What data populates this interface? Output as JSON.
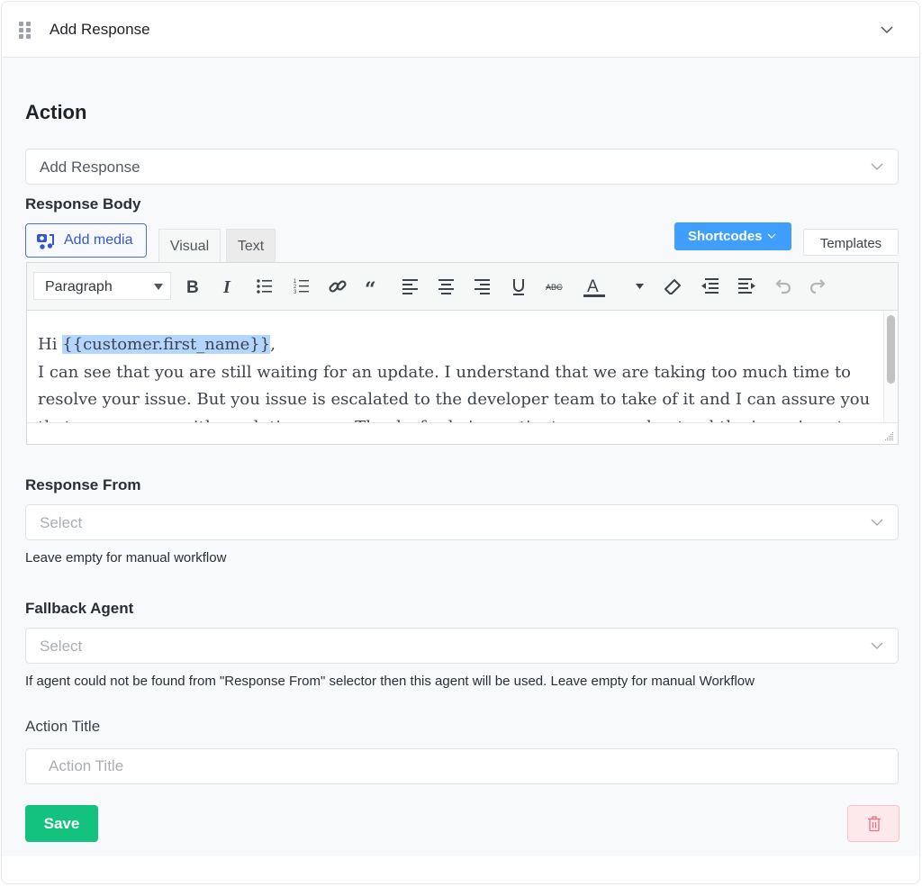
{
  "header": {
    "title": "Add Response",
    "drag_icon": "drag-handle-icon",
    "collapse_icon": "chevron-down-icon"
  },
  "action": {
    "section_title": "Action",
    "selected_action": "Add Response"
  },
  "response_body": {
    "label": "Response Body",
    "add_media_label": "Add media",
    "tabs": [
      {
        "label": "Visual",
        "active": false
      },
      {
        "label": "Text",
        "active": true
      }
    ],
    "shortcodes_label": "Shortcodes",
    "templates_label": "Templates",
    "toolbar": {
      "format_value": "Paragraph",
      "buttons": [
        {
          "name": "bold-icon"
        },
        {
          "name": "italic-icon"
        },
        {
          "name": "bullet-list-icon"
        },
        {
          "name": "numbered-list-icon"
        },
        {
          "name": "link-icon"
        },
        {
          "name": "blockquote-icon"
        },
        {
          "name": "align-left-icon"
        },
        {
          "name": "align-center-icon"
        },
        {
          "name": "align-right-icon"
        },
        {
          "name": "underline-icon"
        },
        {
          "name": "strikethrough-icon"
        },
        {
          "name": "text-color-icon"
        },
        {
          "name": "text-color-dropdown-icon"
        },
        {
          "name": "clear-formatting-icon"
        },
        {
          "name": "outdent-icon"
        },
        {
          "name": "indent-icon"
        },
        {
          "name": "undo-icon"
        },
        {
          "name": "redo-icon"
        }
      ]
    },
    "content": {
      "greeting": "Hi ",
      "shortcode": "{{customer.first_name}}",
      "greeting_end": ",",
      "body": "I can see that you are still waiting for an update. I understand that we are taking too much time to resolve your issue. But you issue is escalated to the developer team to take of it and I can assure you that we come up with a solution soon. Thanks for being patient as you understand the issue is not an"
    }
  },
  "response_from": {
    "label": "Response From",
    "placeholder": "Select",
    "help": "Leave empty for manual workflow"
  },
  "fallback_agent": {
    "label": "Fallback Agent",
    "placeholder": "Select",
    "help": "If agent could not be found from \"Response From\" selector then this agent will be used. Leave empty for manual Workflow"
  },
  "action_title": {
    "label": "Action Title",
    "placeholder": "Action Title",
    "value": ""
  },
  "footer": {
    "save_label": "Save",
    "delete_icon": "trash-icon"
  },
  "colors": {
    "primary_blue": "#409eff",
    "save_green": "#13c27e",
    "delete_red_bg": "#fde9ec",
    "link_blue": "#3558c8",
    "highlight": "#b4d5fe"
  }
}
